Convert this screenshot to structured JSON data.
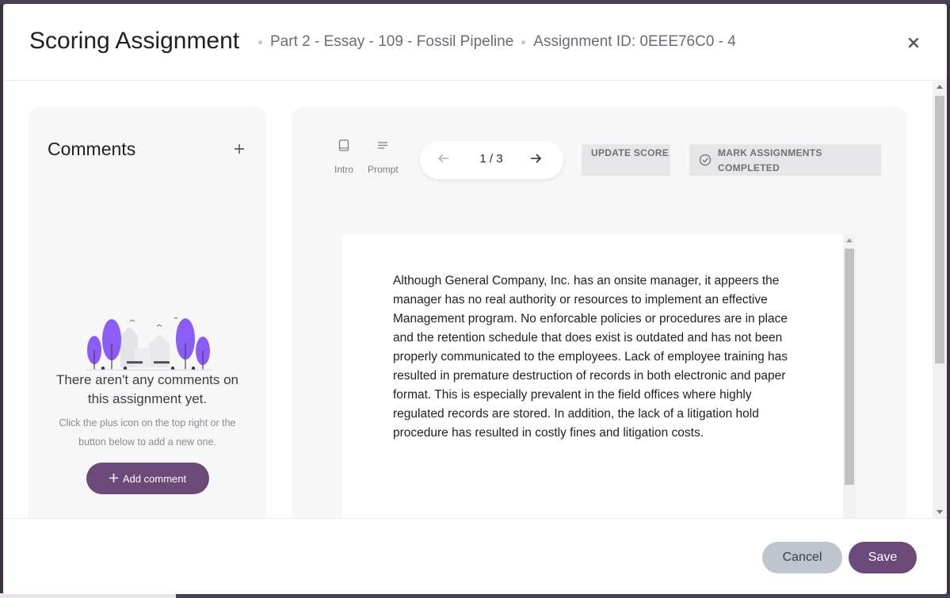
{
  "header": {
    "title": "Scoring Assignment",
    "part": "Part 2 - Essay - 109 - Fossil Pipeline",
    "assignment_id": "Assignment ID: 0EEE76C0 - 4",
    "close_icon": "close-icon"
  },
  "comments": {
    "title": "Comments",
    "add_icon": "plus-icon",
    "empty_title": "There aren't any comments on this assignment yet.",
    "empty_hint": "Click the plus icon on the top right or the button below to add a new one.",
    "add_button_label": "Add comment"
  },
  "viewer": {
    "tools": [
      {
        "label": "Intro",
        "icon": "book-icon"
      },
      {
        "label": "Prompt",
        "icon": "lines-icon"
      }
    ],
    "pager": {
      "current": "1 / 3",
      "prev_icon": "arrow-left-icon",
      "next_icon": "arrow-right-icon"
    },
    "update_score_label": "UPDATE SCORE",
    "mark_completed_label": "MARK ASSIGNMENTS COMPLETED",
    "essay_text": "Although General Company, Inc. has an onsite manager, it appeers the manager has no real authority or resources to implement an effective Management program. No enforcable policies or procedures are in place and the retention schedule that does exist is outdated and has not been properly communicated to the employees. Lack of employee training has resulted in premature destruction of records in both electronic and paper format. This is especially prevalent in the field offices where highly regulated records are stored. In addition, the lack of a litigation hold procedure has resulted in costly fines and litigation costs."
  },
  "footer": {
    "cancel_label": "Cancel",
    "save_label": "Save"
  },
  "colors": {
    "accent": "#6b4a7a",
    "illustration_purple": "#8b5cf6",
    "panel_bg": "#f7f7f8"
  }
}
